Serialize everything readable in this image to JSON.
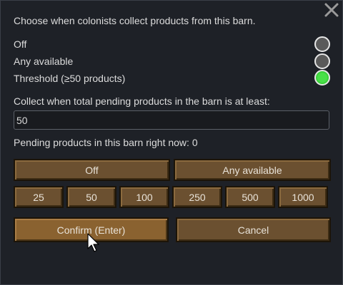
{
  "dialog": {
    "title": "Choose when colonists collect products from this barn.",
    "close_icon": "close-icon"
  },
  "options": [
    {
      "label": "Off",
      "selected": false
    },
    {
      "label": "Any available",
      "selected": false
    },
    {
      "label": "Threshold (≥50 products)",
      "selected": true
    }
  ],
  "threshold": {
    "label": "Collect when total pending products in the barn is at least:",
    "value": "50"
  },
  "pending_text": "Pending products in this barn right now: 0",
  "mode_buttons": {
    "off": "Off",
    "any": "Any available"
  },
  "presets": [
    "25",
    "50",
    "100",
    "250",
    "500",
    "1000"
  ],
  "actions": {
    "confirm": "Confirm (Enter)",
    "cancel": "Cancel"
  },
  "colors": {
    "background": "#1e2127",
    "button": "#6b5030",
    "confirm_button": "#8a6230",
    "radio_selected": "#3ad03a"
  }
}
